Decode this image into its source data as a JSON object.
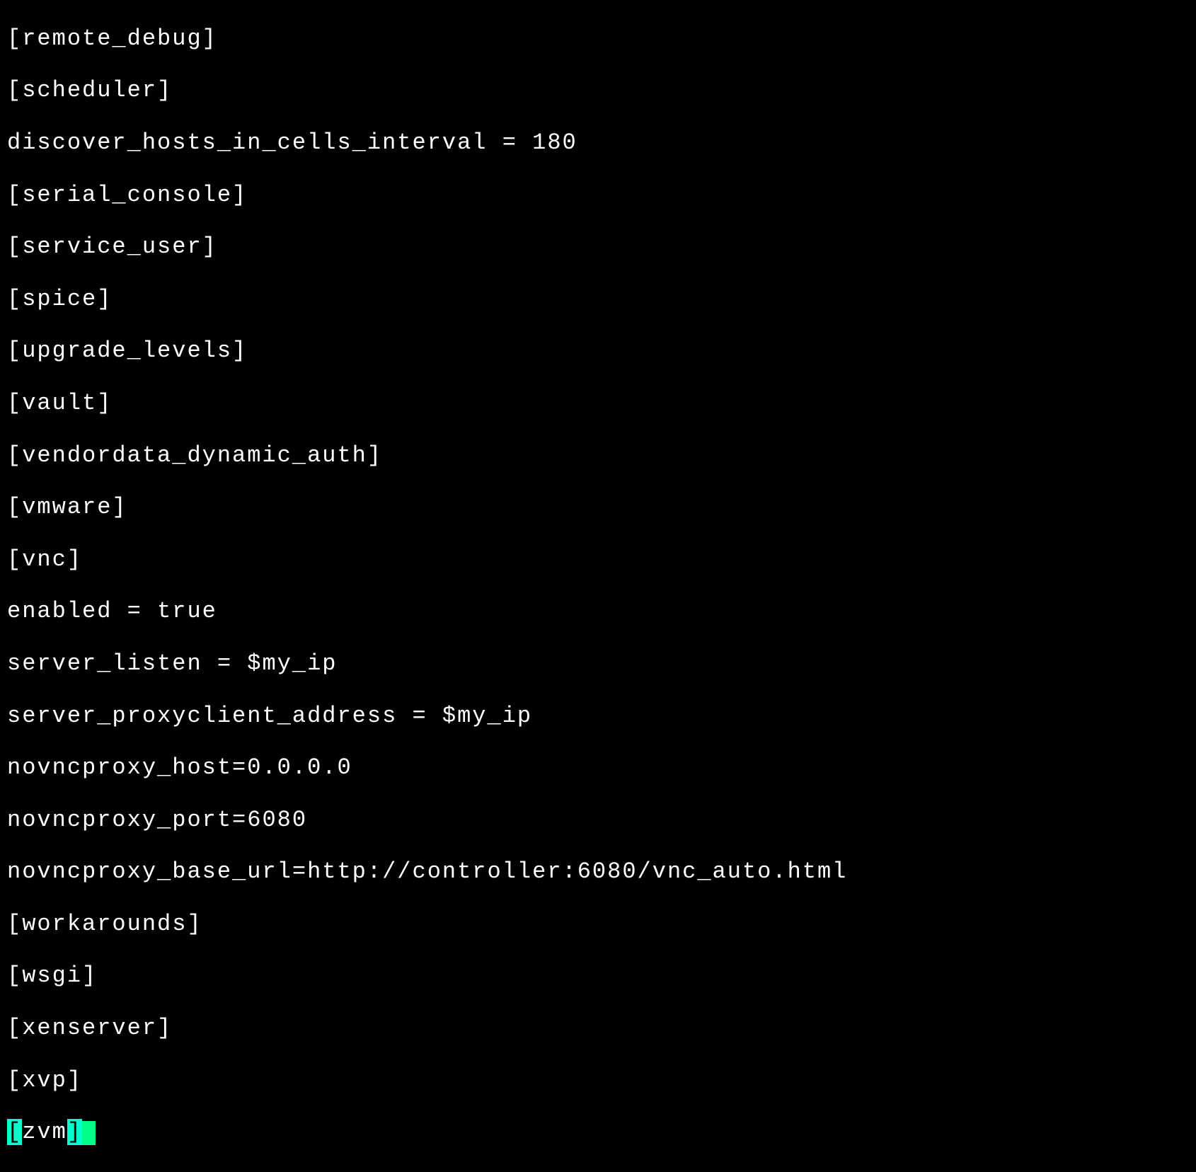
{
  "lines": {
    "l0": "[remote_debug]",
    "l1": "[scheduler]",
    "l2": "discover_hosts_in_cells_interval = 180",
    "l3": "[serial_console]",
    "l4": "[service_user]",
    "l5": "[spice]",
    "l6": "[upgrade_levels]",
    "l7": "[vault]",
    "l8": "[vendordata_dynamic_auth]",
    "l9": "[vmware]",
    "l10": "[vnc]",
    "l11": "enabled = true",
    "l12": "server_listen = $my_ip",
    "l13": "server_proxyclient_address = $my_ip",
    "l14": "novncproxy_host=0.0.0.0",
    "l15": "novncproxy_port=6080",
    "l16": "novncproxy_base_url=http://controller:6080/vnc_auto.html",
    "l17": "[workarounds]",
    "l18": "[wsgi]",
    "l19": "[xenserver]",
    "l20": "[xvp]"
  },
  "cursor_line": {
    "open_bracket": "[",
    "text": "zvm",
    "close_bracket": "]"
  }
}
